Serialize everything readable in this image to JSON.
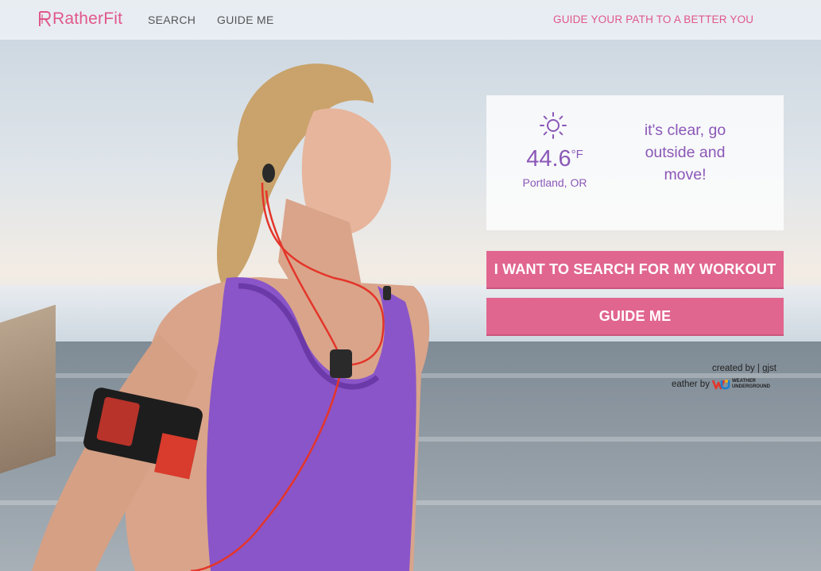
{
  "header": {
    "logo_text": "RatherFit",
    "nav": [
      {
        "label": "SEARCH"
      },
      {
        "label": "GUIDE ME"
      }
    ],
    "tagline": "GUIDE YOUR PATH TO A BETTER YOU"
  },
  "weather": {
    "icon": "sun-icon",
    "temperature": "44.6",
    "unit": "°F",
    "location": "Portland, OR",
    "message": "it's clear, go outside and move!"
  },
  "actions": {
    "search_label": "I WANT TO SEARCH FOR MY WORKOUT",
    "guide_label": "GUIDE ME"
  },
  "credits": {
    "created_by": "created by | gjst",
    "weather_by": "eather by",
    "provider_line1": "WEATHER",
    "provider_line2": "UNDERGROUND"
  },
  "colors": {
    "brand_pink": "#e0578a",
    "button_pink": "#e1668f",
    "weather_purple": "#8b58b8"
  }
}
